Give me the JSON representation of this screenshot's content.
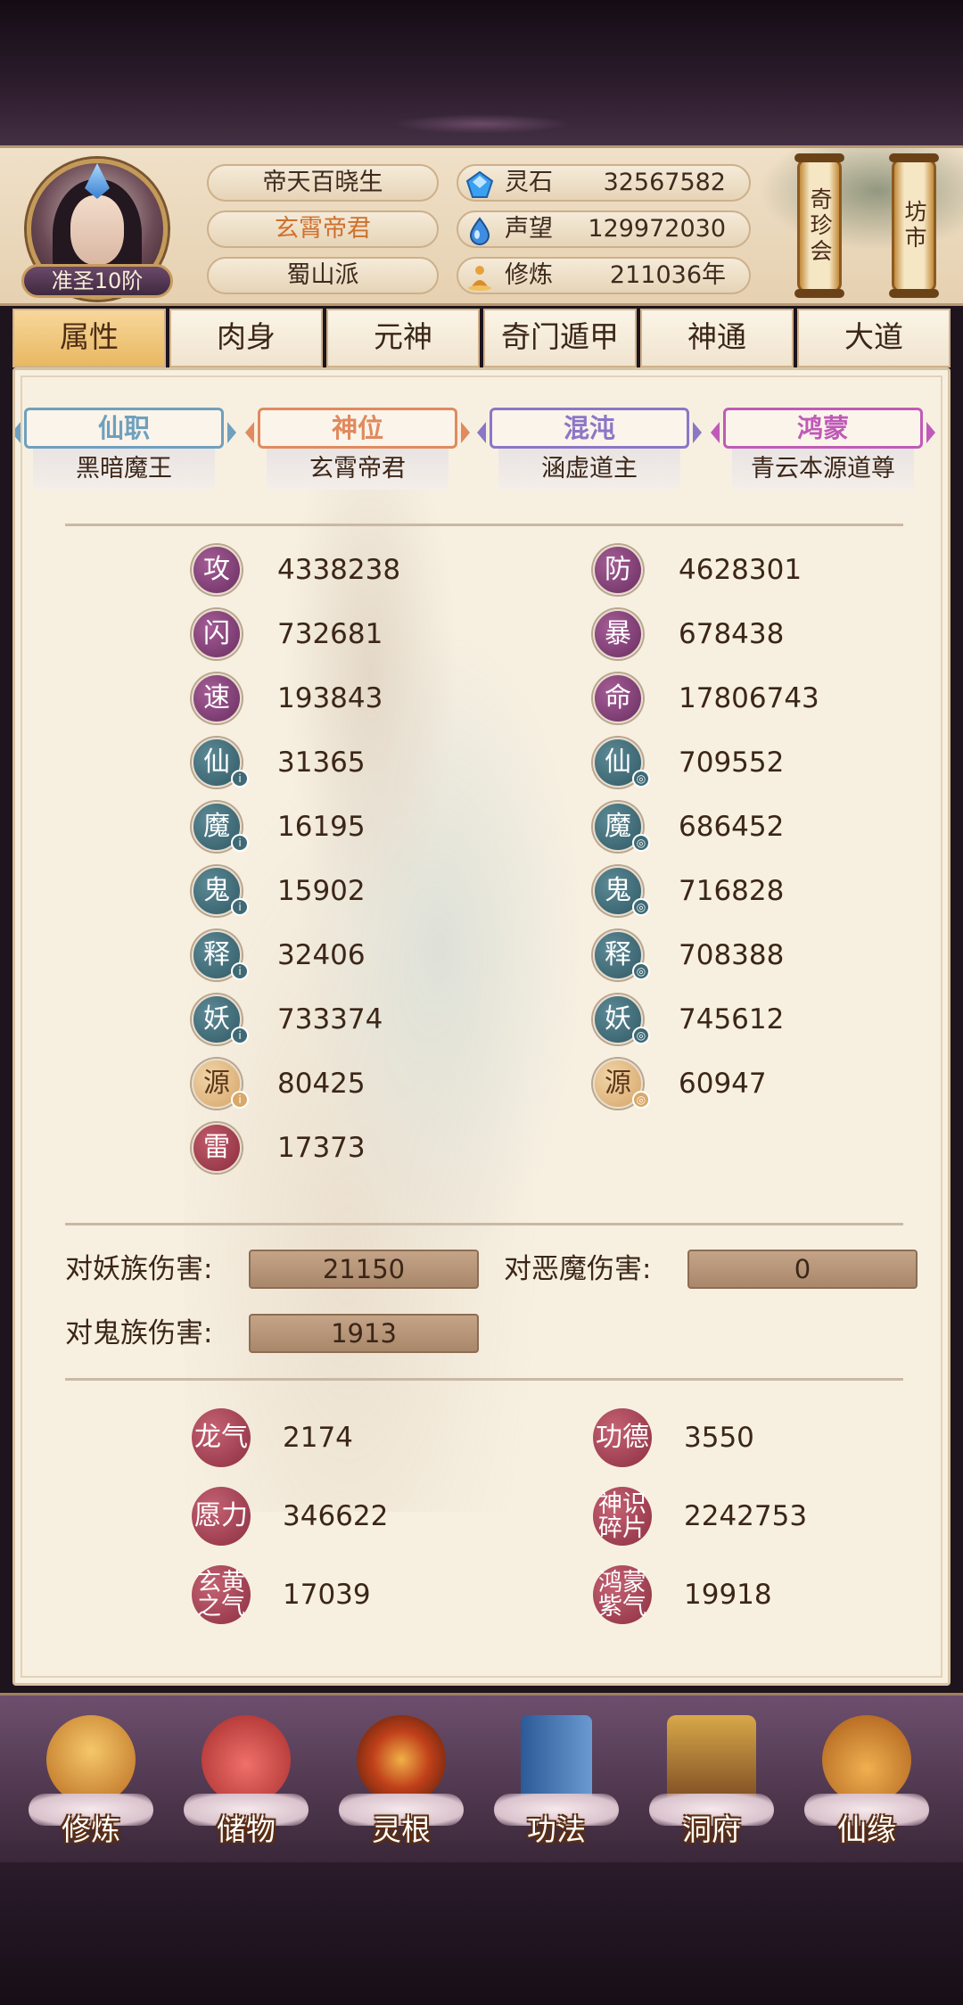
{
  "profile": {
    "rank": "准圣10阶",
    "name": "帝天百晓生",
    "title": "玄霄帝君",
    "sect": "蜀山派"
  },
  "resources": [
    {
      "icon": "spirit-stone-icon",
      "label": "灵石",
      "value": "32567582"
    },
    {
      "icon": "reputation-icon",
      "label": "声望",
      "value": "129972030"
    },
    {
      "icon": "cultivation-icon",
      "label": "修炼",
      "value": "211036年"
    }
  ],
  "side_buttons": {
    "shop": "奇珍会",
    "market": "坊市"
  },
  "tabs": [
    "属性",
    "肉身",
    "元神",
    "奇门遁甲",
    "神通",
    "大道"
  ],
  "active_tab": 0,
  "titles": [
    {
      "head": "仙职",
      "name": "黑暗魔王",
      "color": "#6fa0be"
    },
    {
      "head": "神位",
      "name": "玄霄帝君",
      "color": "#e08a5e"
    },
    {
      "head": "混沌",
      "name": "涵虚道主",
      "color": "#8a77c6"
    },
    {
      "head": "鸿蒙",
      "name": "青云本源道尊",
      "color": "#c05ab8"
    }
  ],
  "stats_left": [
    {
      "glyph": "攻",
      "value": "4338238",
      "style": "purple"
    },
    {
      "glyph": "闪",
      "value": "732681",
      "style": "purple"
    },
    {
      "glyph": "速",
      "value": "193843",
      "style": "purple"
    },
    {
      "glyph": "仙",
      "value": "31365",
      "style": "teal"
    },
    {
      "glyph": "魔",
      "value": "16195",
      "style": "teal"
    },
    {
      "glyph": "鬼",
      "value": "15902",
      "style": "teal"
    },
    {
      "glyph": "释",
      "value": "32406",
      "style": "teal"
    },
    {
      "glyph": "妖",
      "value": "733374",
      "style": "teal"
    },
    {
      "glyph": "源",
      "value": "80425",
      "style": "gold"
    },
    {
      "glyph": "雷",
      "value": "17373",
      "style": "red"
    }
  ],
  "stats_right": [
    {
      "glyph": "防",
      "value": "4628301",
      "style": "purple"
    },
    {
      "glyph": "暴",
      "value": "678438",
      "style": "purple"
    },
    {
      "glyph": "命",
      "value": "17806743",
      "style": "purple"
    },
    {
      "glyph": "仙",
      "value": "709552",
      "style": "teal"
    },
    {
      "glyph": "魔",
      "value": "686452",
      "style": "teal"
    },
    {
      "glyph": "鬼",
      "value": "716828",
      "style": "teal"
    },
    {
      "glyph": "释",
      "value": "708388",
      "style": "teal"
    },
    {
      "glyph": "妖",
      "value": "745612",
      "style": "teal"
    },
    {
      "glyph": "源",
      "value": "60947",
      "style": "gold"
    }
  ],
  "damage": {
    "vs_demon_race_label": "对妖族伤害:",
    "vs_demon_race": "21150",
    "vs_devil_label": "对恶魔伤害:",
    "vs_devil": "0",
    "vs_ghost_label": "对鬼族伤害:",
    "vs_ghost": "1913"
  },
  "extras": {
    "dragon_qi": {
      "label": "龙气",
      "value": "2174"
    },
    "merit": {
      "label": "功德",
      "value": "3550"
    },
    "vow_power": {
      "label": "愿力",
      "value": "346622"
    },
    "divine_sense": {
      "label": "神识碎片",
      "value": "2242753"
    },
    "xuanhuang": {
      "label": "玄黄之气",
      "value": "17039"
    },
    "hongmeng": {
      "label": "鸿蒙紫气",
      "value": "19918"
    }
  },
  "nav": [
    {
      "label": "修炼",
      "icon": "cultivate-icon",
      "color": "#e0a24a"
    },
    {
      "label": "储物",
      "icon": "storage-bag-icon",
      "color": "#d0483e"
    },
    {
      "label": "灵根",
      "icon": "spirit-root-icon",
      "color": "#b83a1a"
    },
    {
      "label": "功法",
      "icon": "technique-book-icon",
      "color": "#3e6fa8"
    },
    {
      "label": "洞府",
      "icon": "cave-dwelling-icon",
      "color": "#9c6a38"
    },
    {
      "label": "仙缘",
      "icon": "gourd-icon",
      "color": "#c0782c"
    }
  ]
}
